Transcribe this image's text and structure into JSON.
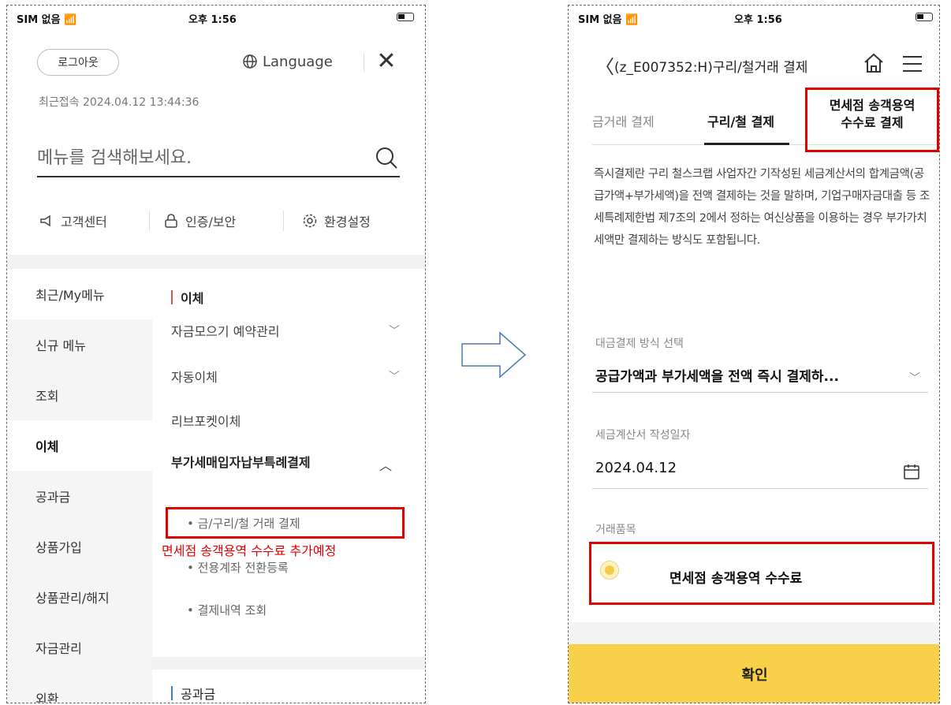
{
  "left": {
    "status": {
      "carrier": "SIM 없음",
      "time": "오후 1:56"
    },
    "logout_label": "로그아웃",
    "language_label": "Language",
    "last_login": "최근접속 2024.04.12 13:44:36",
    "search_placeholder": "메뉴를 검색해보세요.",
    "quick_links": [
      {
        "label": "고객센터",
        "icon": "megaphone-icon"
      },
      {
        "label": "인증/보안",
        "icon": "lock-icon"
      },
      {
        "label": "환경설정",
        "icon": "gear-icon"
      }
    ],
    "nav": [
      "최근/My메뉴",
      "신규 메뉴",
      "조회",
      "이체",
      "공과금",
      "상품가입",
      "상품관리/해지",
      "자금관리",
      "외환"
    ],
    "active_nav": "이체",
    "section_title": "이체",
    "sub_items": [
      "자금모으기 예약관리",
      "자동이체",
      "리브포켓이체"
    ],
    "expanded_item": "부가세매입자납부특례결제",
    "expanded_sub": [
      "금/구리/철 거래 결제",
      "전용계좌 전환등록",
      "결제내역 조회"
    ],
    "annotation": "면세점 송객용역 수수료 추가예정",
    "next_section": "공과금"
  },
  "right": {
    "status": {
      "carrier": "SIM 없음",
      "time": "오후 1:56"
    },
    "title": "(z_E007352:H)구리/철거래 결제",
    "tabs": [
      "금거래 결제",
      "구리/철 결제"
    ],
    "new_tab_line1": "면세점 송객용역",
    "new_tab_line2": "수수료 결제",
    "description": "즉시결제란 구리 철스크랩 사업자간 기작성된 세금계산서의 합계금액(공급가액+부가세액)을 전액 결제하는 것을 말하며, 기업구매자금대출 등 조세특례제한법 제7조의 2에서 정하는 여신상품을 이용하는 경우 부가가치세액만 결제하는 방식도 포함됩니다.",
    "method_label": "대금결제 방식 선택",
    "method_value": "공급가액과 부가세액을 전액 즉시 결제하...",
    "date_label": "세금계산서 작성일자",
    "date_value": "2024.04.12",
    "item_label": "거래품목",
    "item_option": "면세점 송객용역 수수료",
    "confirm_label": "확인"
  },
  "colors": {
    "highlight_red": "#e00000",
    "confirm_yellow": "#f8d04a",
    "radio_yellow": "#f7c948"
  }
}
